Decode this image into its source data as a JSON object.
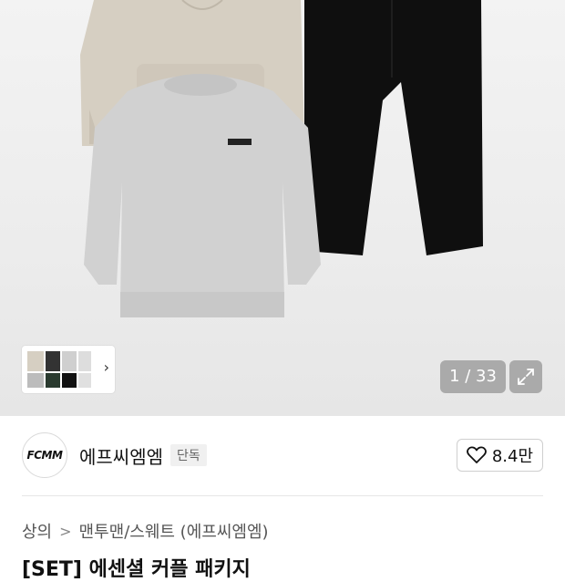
{
  "gallery": {
    "current": "1",
    "total": "33",
    "counter_text": "1 / 33",
    "thumbnail_arrow": "›"
  },
  "brand": {
    "logo_text": "FCMM",
    "name": "에프씨엠엠",
    "badge": "단독",
    "like_count": "8.4만"
  },
  "breadcrumb": {
    "items": [
      "상의",
      "맨투맨/스웨트 (에프씨엠엠)"
    ]
  },
  "product": {
    "title_partial": "[SET] 에센셜 커플 패키지"
  },
  "icons": {
    "expand": "expand-icon",
    "heart": "heart-outline-icon",
    "chevron": "chevron-right-icon"
  },
  "colors": {
    "hoodie": "#d8d0c3",
    "sweatshirt": "#d0d0d0",
    "pants": "#111111",
    "counter_bg": "#979797"
  }
}
